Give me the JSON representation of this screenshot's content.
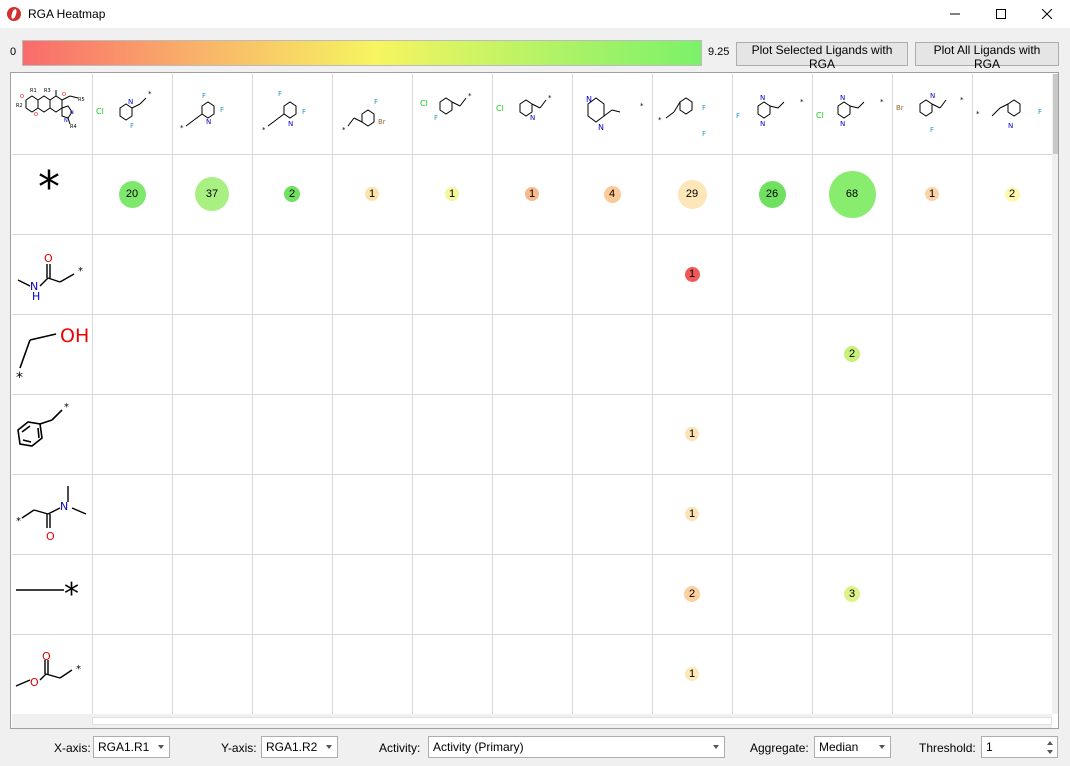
{
  "window": {
    "title": "RGA Heatmap"
  },
  "colorscale": {
    "min": "0",
    "max": "9.25",
    "low_color": "#f96b6b",
    "mid_color": "#f6f560",
    "high_color": "#7bf16a"
  },
  "toolbar": {
    "plot_selected": "Plot Selected Ligands with RGA",
    "plot_all": "Plot All Ligands with RGA"
  },
  "columns": [
    {
      "r1": "",
      "structure": "core-scaffold"
    },
    {
      "r1": "",
      "structure": "chloro-fluoro-pyridylmethyl"
    },
    {
      "r1": "",
      "structure": "fluoro-pyridylmethyl-a"
    },
    {
      "r1": "",
      "structure": "fluoro-dihydropyridylmethyl"
    },
    {
      "r1": "",
      "structure": "bromo-fluoro-benzyl"
    },
    {
      "r1": "",
      "structure": "chloro-fluoro-benzyl"
    },
    {
      "r1": "",
      "structure": "chloro-pyridylmethyl"
    },
    {
      "r1": "",
      "structure": "pyrazinylmethyl"
    },
    {
      "r1": "",
      "structure": "difluoro-benzyl"
    },
    {
      "r1": "",
      "structure": "fluoro-pyrimidinylmethyl"
    },
    {
      "r1": "",
      "structure": "chloro-pyrimidinylmethyl"
    },
    {
      "r1": "",
      "structure": "bromo-fluoro-pyridylmethyl"
    },
    {
      "r1": "",
      "structure": "fluoro-pyridylmethyl-b"
    }
  ],
  "rows": [
    {
      "structure": "hydrogen",
      "label": "*"
    },
    {
      "structure": "n-methylacetamide"
    },
    {
      "structure": "hydroxyethyl"
    },
    {
      "structure": "benzyl"
    },
    {
      "structure": "n-n-dimethylacetamide"
    },
    {
      "structure": "methyl"
    },
    {
      "structure": "methyl-acetate"
    }
  ],
  "cells": [
    {
      "row": 0,
      "col": 1,
      "count": "20",
      "color": "#7de86c",
      "size": 27
    },
    {
      "row": 0,
      "col": 2,
      "count": "37",
      "color": "#a9f083",
      "size": 34
    },
    {
      "row": 0,
      "col": 3,
      "count": "2",
      "color": "#6fe060",
      "size": 16
    },
    {
      "row": 0,
      "col": 4,
      "count": "1",
      "color": "#fbe3a9",
      "size": 14
    },
    {
      "row": 0,
      "col": 5,
      "count": "1",
      "color": "#f1f79a",
      "size": 14
    },
    {
      "row": 0,
      "col": 6,
      "count": "1",
      "color": "#f8b98c",
      "size": 14
    },
    {
      "row": 0,
      "col": 7,
      "count": "4",
      "color": "#fbca98",
      "size": 17
    },
    {
      "row": 0,
      "col": 8,
      "count": "29",
      "color": "#fde6b8",
      "size": 29
    },
    {
      "row": 0,
      "col": 9,
      "count": "26",
      "color": "#6fe060",
      "size": 27
    },
    {
      "row": 0,
      "col": 10,
      "count": "68",
      "color": "#88ec6e",
      "size": 47
    },
    {
      "row": 0,
      "col": 11,
      "count": "1",
      "color": "#fbd3a8",
      "size": 14
    },
    {
      "row": 0,
      "col": 12,
      "count": "2",
      "color": "#fdf7b0",
      "size": 15
    },
    {
      "row": 1,
      "col": 8,
      "count": "1",
      "color": "#ef5858",
      "size": 15
    },
    {
      "row": 2,
      "col": 10,
      "count": "2",
      "color": "#c8f078",
      "size": 16
    },
    {
      "row": 3,
      "col": 8,
      "count": "1",
      "color": "#fde2b5",
      "size": 14
    },
    {
      "row": 4,
      "col": 8,
      "count": "1",
      "color": "#fde2b5",
      "size": 14
    },
    {
      "row": 5,
      "col": 8,
      "count": "2",
      "color": "#fbd0a0",
      "size": 16
    },
    {
      "row": 5,
      "col": 10,
      "count": "3",
      "color": "#def28c",
      "size": 16
    },
    {
      "row": 6,
      "col": 8,
      "count": "1",
      "color": "#fde8b8",
      "size": 14
    }
  ],
  "footer": {
    "xaxis_label": "X-axis:",
    "xaxis_value": "RGA1.R1",
    "yaxis_label": "Y-axis:",
    "yaxis_value": "RGA1.R2",
    "activity_label": "Activity:",
    "activity_value": "Activity (Primary)",
    "aggregate_label": "Aggregate:",
    "aggregate_value": "Median",
    "threshold_label": "Threshold:",
    "threshold_value": "1"
  }
}
